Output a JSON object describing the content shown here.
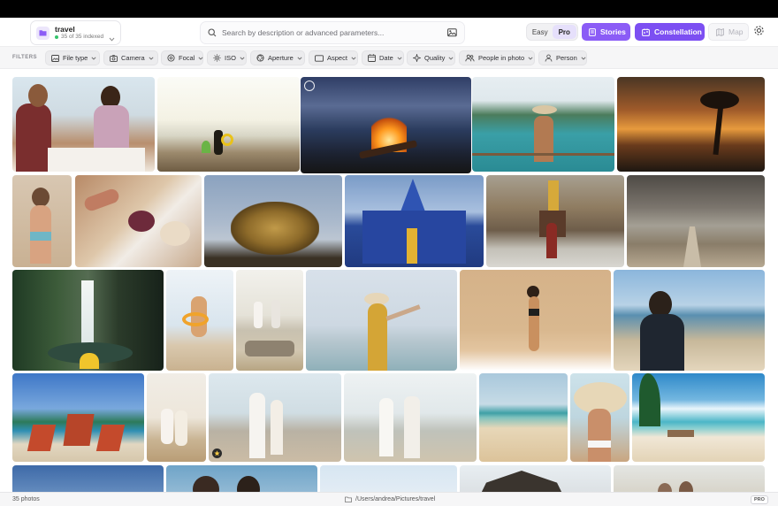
{
  "library": {
    "name": "travel",
    "indexed": "35 of 35 indexed"
  },
  "search": {
    "placeholder": "Search by description or advanced parameters..."
  },
  "mode": {
    "easy": "Easy",
    "pro": "Pro",
    "selected": "Pro"
  },
  "actions": {
    "stories": "Stories",
    "constellation": "Constellation",
    "map": "Map"
  },
  "filters": {
    "label": "FILTERS",
    "chips": [
      {
        "label": "File type",
        "icon": "image-icon"
      },
      {
        "label": "Camera",
        "icon": "camera-icon"
      },
      {
        "label": "Focal",
        "icon": "focus-icon"
      },
      {
        "label": "ISO",
        "icon": "iso-icon"
      },
      {
        "label": "Aperture",
        "icon": "aperture-icon"
      },
      {
        "label": "Aspect",
        "icon": "aspect-icon"
      },
      {
        "label": "Date",
        "icon": "calendar-icon"
      },
      {
        "label": "Quality",
        "icon": "sparkle-icon"
      },
      {
        "label": "People in photo",
        "icon": "people-icon"
      },
      {
        "label": "Person",
        "icon": "person-icon"
      }
    ]
  },
  "colors": {
    "accent": "#8b5cf6",
    "accent_dark": "#7c4ff2",
    "indexed_dot": "#35c46b"
  },
  "status": {
    "count": "35 photos",
    "path": "/Users/andrea/Pictures/travel",
    "badge": "PRO"
  }
}
